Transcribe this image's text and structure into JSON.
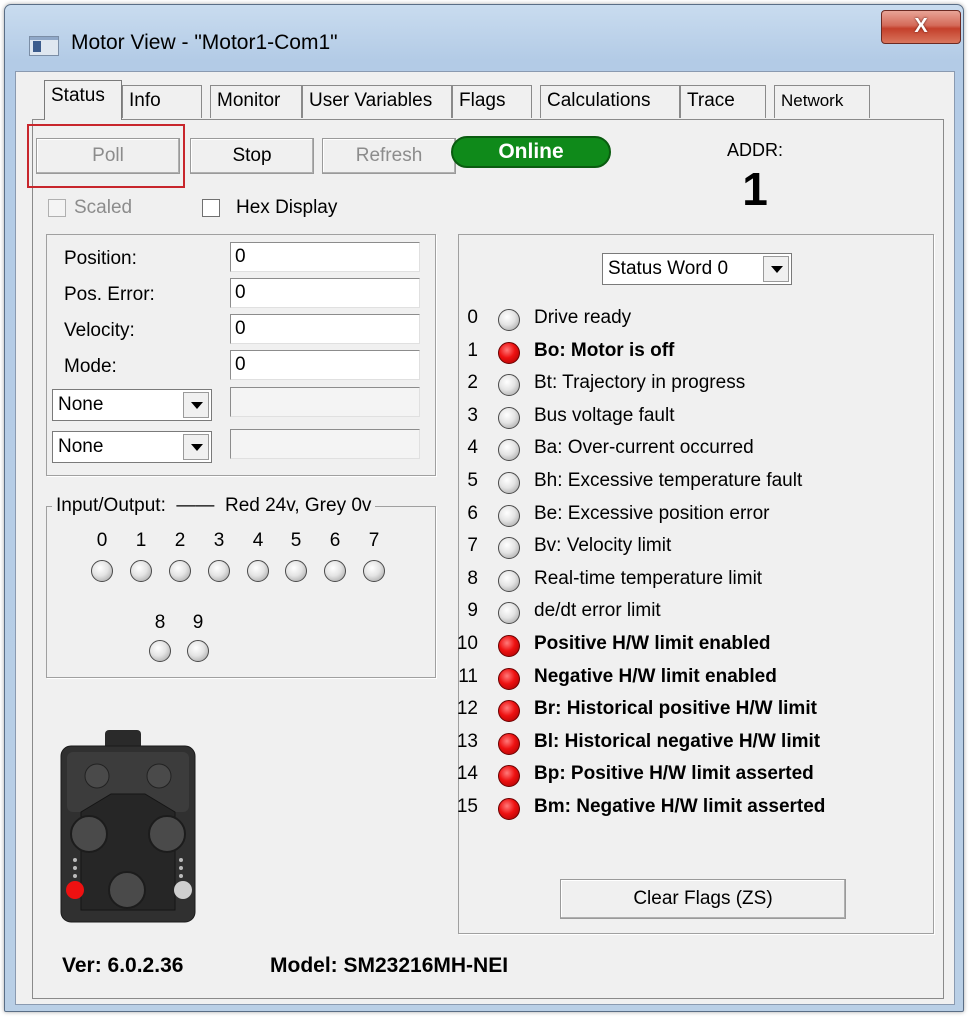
{
  "window": {
    "title": "Motor View - \"Motor1-Com1\"",
    "close_label": "X"
  },
  "tabs": [
    {
      "label": "Status",
      "active": true
    },
    {
      "label": "Info"
    },
    {
      "label": "Monitor"
    },
    {
      "label": "User Variables"
    },
    {
      "label": "Flags"
    },
    {
      "label": "Calculations"
    },
    {
      "label": "Trace"
    },
    {
      "label": "Network"
    }
  ],
  "toolbar": {
    "poll_label": "Poll",
    "stop_label": "Stop",
    "refresh_label": "Refresh"
  },
  "connection": {
    "status": "Online",
    "addr_label": "ADDR:",
    "addr_value": "1"
  },
  "options": {
    "scaled_label": "Scaled",
    "scaled_checked": false,
    "hex_label": "Hex Display",
    "hex_checked": false
  },
  "readouts": {
    "position_label": "Position:",
    "position_value": "0",
    "pos_error_label": "Pos. Error:",
    "pos_error_value": "0",
    "velocity_label": "Velocity:",
    "velocity_value": "0",
    "mode_label": "Mode:",
    "mode_value": "0",
    "select1_value": "None",
    "select1_field": "",
    "select2_value": "None",
    "select2_field": ""
  },
  "io": {
    "title": "Input/Output:",
    "legend": "Red 24v, Grey 0v",
    "pins": [
      {
        "label": "0",
        "on": false
      },
      {
        "label": "1",
        "on": false
      },
      {
        "label": "2",
        "on": false
      },
      {
        "label": "3",
        "on": false
      },
      {
        "label": "4",
        "on": false
      },
      {
        "label": "5",
        "on": false
      },
      {
        "label": "6",
        "on": false
      },
      {
        "label": "7",
        "on": false
      },
      {
        "label": "8",
        "on": false
      },
      {
        "label": "9",
        "on": false
      }
    ]
  },
  "status_word": {
    "selected": "Status Word 0",
    "bits": [
      {
        "num": "0",
        "label": "Drive ready",
        "on": false
      },
      {
        "num": "1",
        "label": "Bo:  Motor is off",
        "on": true
      },
      {
        "num": "2",
        "label": "Bt:  Trajectory in progress",
        "on": false
      },
      {
        "num": "3",
        "label": "Bus voltage fault",
        "on": false
      },
      {
        "num": "4",
        "label": "Ba:  Over-current occurred",
        "on": false
      },
      {
        "num": "5",
        "label": "Bh:  Excessive temperature fault",
        "on": false
      },
      {
        "num": "6",
        "label": "Be:  Excessive position error",
        "on": false
      },
      {
        "num": "7",
        "label": "Bv:  Velocity limit",
        "on": false
      },
      {
        "num": "8",
        "label": "Real-time temperature limit",
        "on": false
      },
      {
        "num": "9",
        "label": "de/dt error limit",
        "on": false
      },
      {
        "num": "10",
        "label": "Positive H/W limit enabled",
        "on": true
      },
      {
        "num": "11",
        "label": "Negative H/W limit enabled",
        "on": true
      },
      {
        "num": "12",
        "label": "Br:  Historical positive H/W limit",
        "on": true
      },
      {
        "num": "13",
        "label": "Bl:  Historical negative H/W limit",
        "on": true
      },
      {
        "num": "14",
        "label": "Bp:  Positive H/W limit asserted",
        "on": true
      },
      {
        "num": "15",
        "label": "Bm:  Negative H/W limit asserted",
        "on": true
      }
    ],
    "clear_label": "Clear Flags (ZS)"
  },
  "footer": {
    "version": "Ver: 6.0.2.36",
    "model": "Model: SM23216MH-NEI"
  },
  "colors": {
    "led_on": "#ee1111",
    "led_off": "#d8d8d8",
    "online": "#0f8a1a",
    "focus": "#c8262c"
  }
}
